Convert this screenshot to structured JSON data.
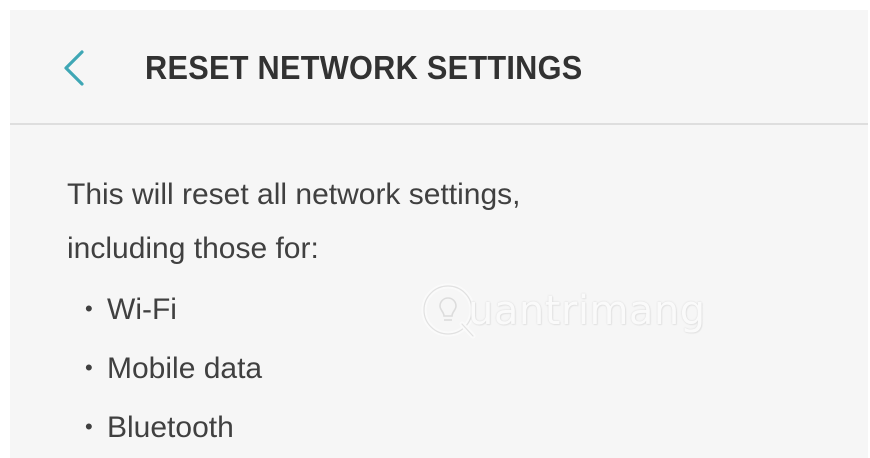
{
  "header": {
    "title": "RESET NETWORK SETTINGS",
    "back_icon": "chevron-left-icon"
  },
  "content": {
    "description_line1": "This will reset all network settings,",
    "description_line2": "including those for:",
    "items": [
      "Wi-Fi",
      "Mobile data",
      "Bluetooth"
    ],
    "bullet": "•"
  },
  "watermark": {
    "text": "uantrimang",
    "icon": "lightbulb-q-logo"
  },
  "colors": {
    "background": "#f6f6f6",
    "accent": "#3fa7b5",
    "title": "#323232",
    "body_text": "#404040",
    "divider": "#dedede"
  }
}
